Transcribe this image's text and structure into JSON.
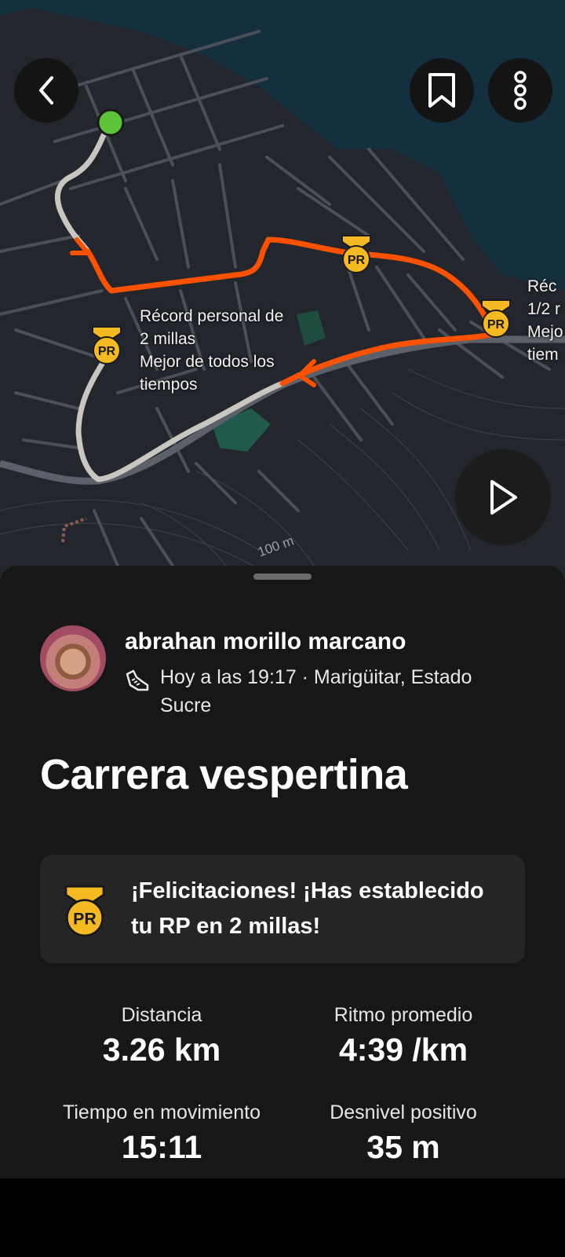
{
  "map": {
    "pr_label_2mi": "Récord personal de\n2 millas\nMejor de todos los\ntiempos",
    "pr_label_half": "Réc\n1/2 r\nMejo\ntiem",
    "pr_badge_text": "PR",
    "scale": "100 m",
    "icons": {
      "back": "chevron-left-icon",
      "bookmark": "bookmark-icon",
      "more": "more-vertical-icon",
      "play": "play-icon"
    }
  },
  "activity": {
    "athlete_name": "abrahan morillo marcano",
    "meta": "Hoy a las 19:17 · Marigüitar, Estado Sucre",
    "title": "Carrera vespertina",
    "pr_message": "¡Felicitaciones! ¡Has establecido tu RP en 2 millas!",
    "stats": [
      {
        "label": "Distancia",
        "value": "3.26 km"
      },
      {
        "label": "Ritmo promedio",
        "value": "4:39 /km"
      },
      {
        "label": "Tiempo en movimiento",
        "value": "15:11"
      },
      {
        "label": "Desnivel positivo",
        "value": "35 m"
      }
    ]
  },
  "colors": {
    "route_orange": "#fc5200",
    "route_gray": "#c9c6c0",
    "pr_gold": "#f5b921",
    "start_green": "#5ec43b",
    "sea": "#14303f",
    "land": "#23262d",
    "sheet_bg": "#171717"
  }
}
